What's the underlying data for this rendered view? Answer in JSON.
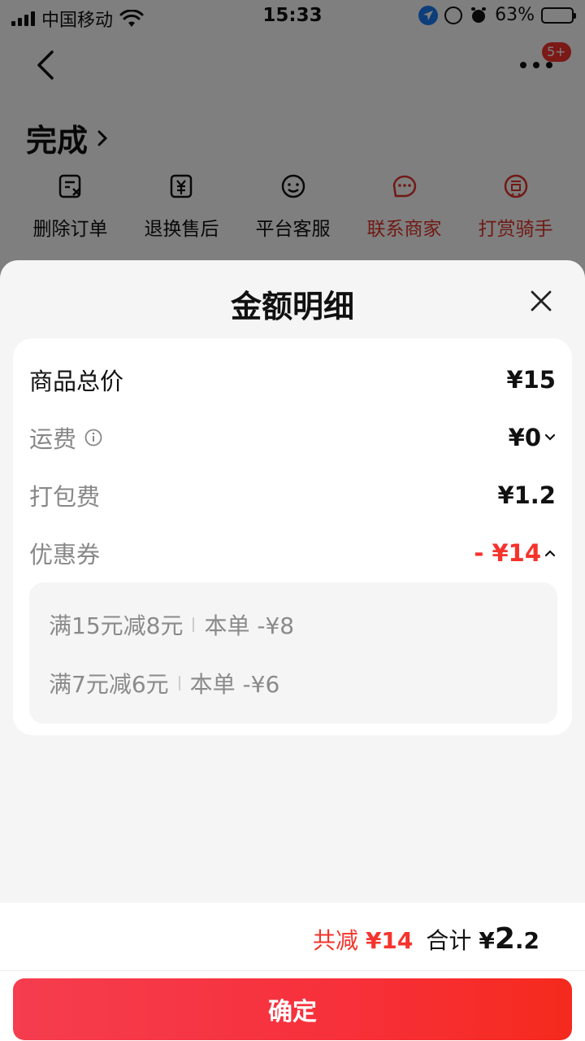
{
  "status_bar": {
    "carrier": "中国移动",
    "time": "15:33",
    "battery": "63%",
    "battery_level": 0.63
  },
  "nav": {
    "badge": "5+"
  },
  "order": {
    "status": "完成",
    "actions": [
      {
        "label": "删除订单",
        "icon": "delete-order-icon",
        "color": "#111111"
      },
      {
        "label": "退换售后",
        "icon": "refund-icon",
        "color": "#111111"
      },
      {
        "label": "平台客服",
        "icon": "customer-service-icon",
        "color": "#111111"
      },
      {
        "label": "联系商家",
        "icon": "contact-merchant-icon",
        "color": "#e0352b"
      },
      {
        "label": "打赏骑手",
        "icon": "tip-rider-icon",
        "color": "#e0352b"
      }
    ]
  },
  "sheet": {
    "title": "金额明细",
    "rows": {
      "goods_total": {
        "label": "商品总价",
        "value": "¥15"
      },
      "shipping": {
        "label": "运费",
        "value": "¥0"
      },
      "packing": {
        "label": "打包费",
        "value": "¥1.2"
      },
      "coupon": {
        "label": "优惠券",
        "value": "- ¥14"
      }
    },
    "coupons": [
      {
        "rule": "满15元减8元",
        "deduction": "本单 -¥8"
      },
      {
        "rule": "满7元减6元",
        "deduction": "本单 -¥6"
      }
    ]
  },
  "footer": {
    "reduce_label": "共减",
    "reduce_value": "¥14",
    "total_label": "合计",
    "total_currency": "¥",
    "total_int": "2",
    "total_dec": ".2",
    "confirm": "确定"
  },
  "colors": {
    "accent_red": "#f5332c",
    "sheet_bg": "#f5f5f5"
  }
}
